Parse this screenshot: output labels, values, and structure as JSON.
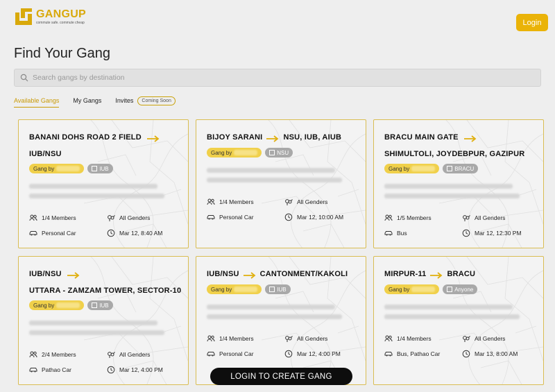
{
  "brand": {
    "name": "GANGUP",
    "tagline": "commute safe. commute cheap"
  },
  "header": {
    "login_label": "Login"
  },
  "page": {
    "title": "Find Your Gang"
  },
  "search": {
    "placeholder": "Search gangs by destination"
  },
  "tabs": [
    {
      "label": "Available Gangs",
      "active": true
    },
    {
      "label": "My Gangs"
    },
    {
      "label": "Invites",
      "badge": "Coming Soon"
    }
  ],
  "gang_prefix": "Gang by",
  "cards": [
    {
      "from": "BANANI DOHS ROAD 2 FIELD",
      "to": "IUB/NSU",
      "institution": "IUB",
      "members": "1/4 Members",
      "gender": "All Genders",
      "vehicle": "Personal Car",
      "time": "Mar 12, 8:40 AM"
    },
    {
      "from": "BIJOY SARANI",
      "to": "NSU, IUB, AIUB",
      "institution": "NSU",
      "members": "1/4 Members",
      "gender": "All Genders",
      "vehicle": "Personal Car",
      "time": "Mar 12, 10:00 AM"
    },
    {
      "from": "BRACU MAIN GATE",
      "to": "SHIMULTOLI, JOYDEBPUR, GAZIPUR",
      "institution": "BRACU",
      "members": "1/5 Members",
      "gender": "All Genders",
      "vehicle": "Bus",
      "time": "Mar 12, 12:30 PM"
    },
    {
      "from": "IUB/NSU",
      "to": "UTTARA - ZAMZAM TOWER, SECTOR-10",
      "institution": "IUB",
      "members": "2/4 Members",
      "gender": "All Genders",
      "vehicle": "Pathao Car",
      "time": "Mar 12, 4:00 PM"
    },
    {
      "from": "IUB/NSU",
      "to": "CANTONMENT/KAKOLI",
      "institution": "IUB",
      "members": "1/4 Members",
      "gender": "All Genders",
      "vehicle": "Personal Car",
      "time": "Mar 12, 4:00 PM"
    },
    {
      "from": "MIRPUR-11",
      "to": "BRACU",
      "institution": "Anyone",
      "members": "1/4 Members",
      "gender": "All Genders",
      "vehicle": "Bus, Pathao Car",
      "time": "Mar 13, 8:00 AM"
    }
  ],
  "cta": {
    "label": "LOGIN TO CREATE GANG"
  },
  "colors": {
    "accent": "#eab308",
    "card_border": "#d9bd52",
    "cta_bg": "#0d0d0d"
  }
}
